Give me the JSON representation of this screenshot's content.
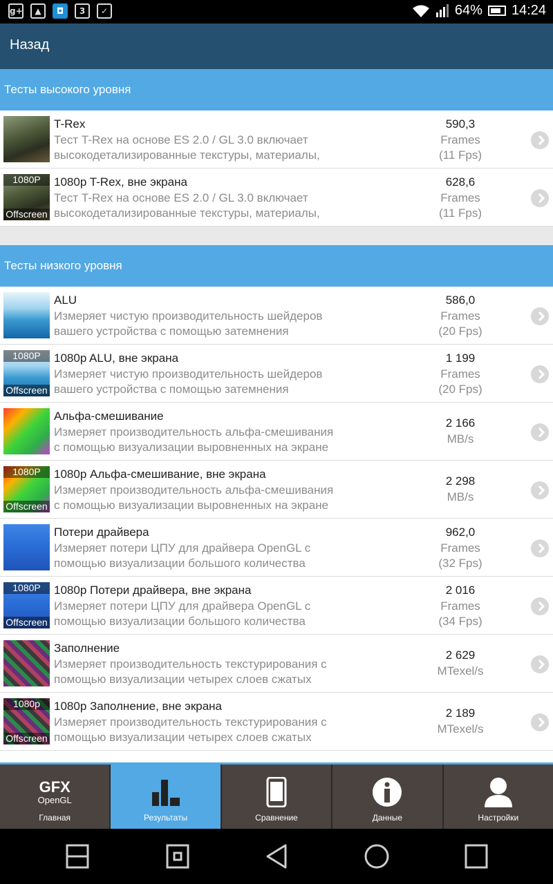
{
  "status_bar": {
    "icons": [
      "google-plus-icon",
      "gallery-icon",
      "store-icon",
      "app-3d-icon",
      "bag-check-icon"
    ],
    "battery_percent": "64%",
    "time": "14:24"
  },
  "app_bar": {
    "title": "Назад"
  },
  "sections": [
    {
      "header": "Тесты высокого уровня",
      "rows": [
        {
          "title": "T-Rex",
          "desc1": "Тест T-Rex на основе ES 2.0 / GL 3.0 включает",
          "desc2": "высокодетализированные текстуры, материалы,",
          "value": "590,3",
          "unit": "Frames",
          "fps": "(11 Fps)",
          "thumb": "trex",
          "tag_top": "",
          "tag_bottom": ""
        },
        {
          "title": "1080p T-Rex, вне экрана",
          "desc1": "Тест T-Rex на основе ES 2.0 / GL 3.0 включает",
          "desc2": "высокодетализированные текстуры, материалы,",
          "value": "628,6",
          "unit": "Frames",
          "fps": "(11 Fps)",
          "thumb": "trex",
          "tag_top": "1080P",
          "tag_bottom": "Offscreen"
        }
      ]
    },
    {
      "header": "Тесты низкого уровня",
      "rows": [
        {
          "title": "ALU",
          "desc1": "Измеряет чистую производительность шейдеров",
          "desc2": "вашего устройства с помощью затемнения",
          "value": "586,0",
          "unit": "Frames",
          "fps": "(20 Fps)",
          "thumb": "alu",
          "tag_top": "",
          "tag_bottom": ""
        },
        {
          "title": "1080p ALU, вне экрана",
          "desc1": "Измеряет чистую производительность шейдеров",
          "desc2": "вашего устройства с помощью затемнения",
          "value": "1 199",
          "unit": "Frames",
          "fps": "(20 Fps)",
          "thumb": "alu",
          "tag_top": "1080P",
          "tag_bottom": "Offscreen"
        },
        {
          "title": "Альфа-смешивание",
          "desc1": "Измеряет производительность альфа-смешивания",
          "desc2": "с помощью визуализации выровненных на экране",
          "value": "2 166",
          "unit": "MB/s",
          "fps": "",
          "thumb": "alpha",
          "tag_top": "",
          "tag_bottom": ""
        },
        {
          "title": "1080p Альфа-смешивание, вне экрана",
          "desc1": "Измеряет производительность альфа-смешивания",
          "desc2": "с помощью визуализации выровненных на экране",
          "value": "2 298",
          "unit": "MB/s",
          "fps": "",
          "thumb": "alpha",
          "tag_top": "1080P",
          "tag_bottom": "Offscreen"
        },
        {
          "title": "Потери драйвера",
          "desc1": "Измеряет потери ЦПУ для драйвера OpenGL с",
          "desc2": "помощью визуализации большого количества",
          "value": "962,0",
          "unit": "Frames",
          "fps": "(32 Fps)",
          "thumb": "driver",
          "tag_top": "",
          "tag_bottom": ""
        },
        {
          "title": "1080p Потери драйвера, вне экрана",
          "desc1": "Измеряет потери ЦПУ для драйвера OpenGL с",
          "desc2": "помощью визуализации большого количества",
          "value": "2 016",
          "unit": "Frames",
          "fps": "(34 Fps)",
          "thumb": "driver",
          "tag_top": "1080P",
          "tag_bottom": "Offscreen"
        },
        {
          "title": "Заполнение",
          "desc1": "Измеряет производительность текстурирования с",
          "desc2": "помощью визуализации четырех слоев сжатых",
          "value": "2 629",
          "unit": "MTexel/s",
          "fps": "",
          "thumb": "fill",
          "tag_top": "",
          "tag_bottom": ""
        },
        {
          "title": "1080p Заполнение, вне экрана",
          "desc1": "Измеряет производительность текстурирования с",
          "desc2": "помощью визуализации четырех слоев сжатых",
          "value": "2 189",
          "unit": "MTexel/s",
          "fps": "",
          "thumb": "fill",
          "tag_top": "1080p",
          "tag_bottom": "Offscreen"
        }
      ]
    }
  ],
  "tabs": [
    {
      "label": "Главная",
      "icon": "gfx-opengl-logo",
      "logo_top": "GFX",
      "logo_bottom": "OpenGL",
      "active": false
    },
    {
      "label": "Результаты",
      "icon": "bar-chart-icon",
      "active": true
    },
    {
      "label": "Сравнение",
      "icon": "phone-icon",
      "active": false
    },
    {
      "label": "Данные",
      "icon": "info-icon",
      "active": false
    },
    {
      "label": "Настройки",
      "icon": "user-icon",
      "active": false
    }
  ],
  "nav_buttons": [
    "split-screen-icon",
    "home-square-icon",
    "back-icon",
    "home-circle-icon",
    "recents-icon"
  ],
  "colors": {
    "app_bar": "#26506f",
    "section_header": "#52a9e3",
    "tab_bar": "#4a4340",
    "tab_active": "#52a9e3"
  }
}
